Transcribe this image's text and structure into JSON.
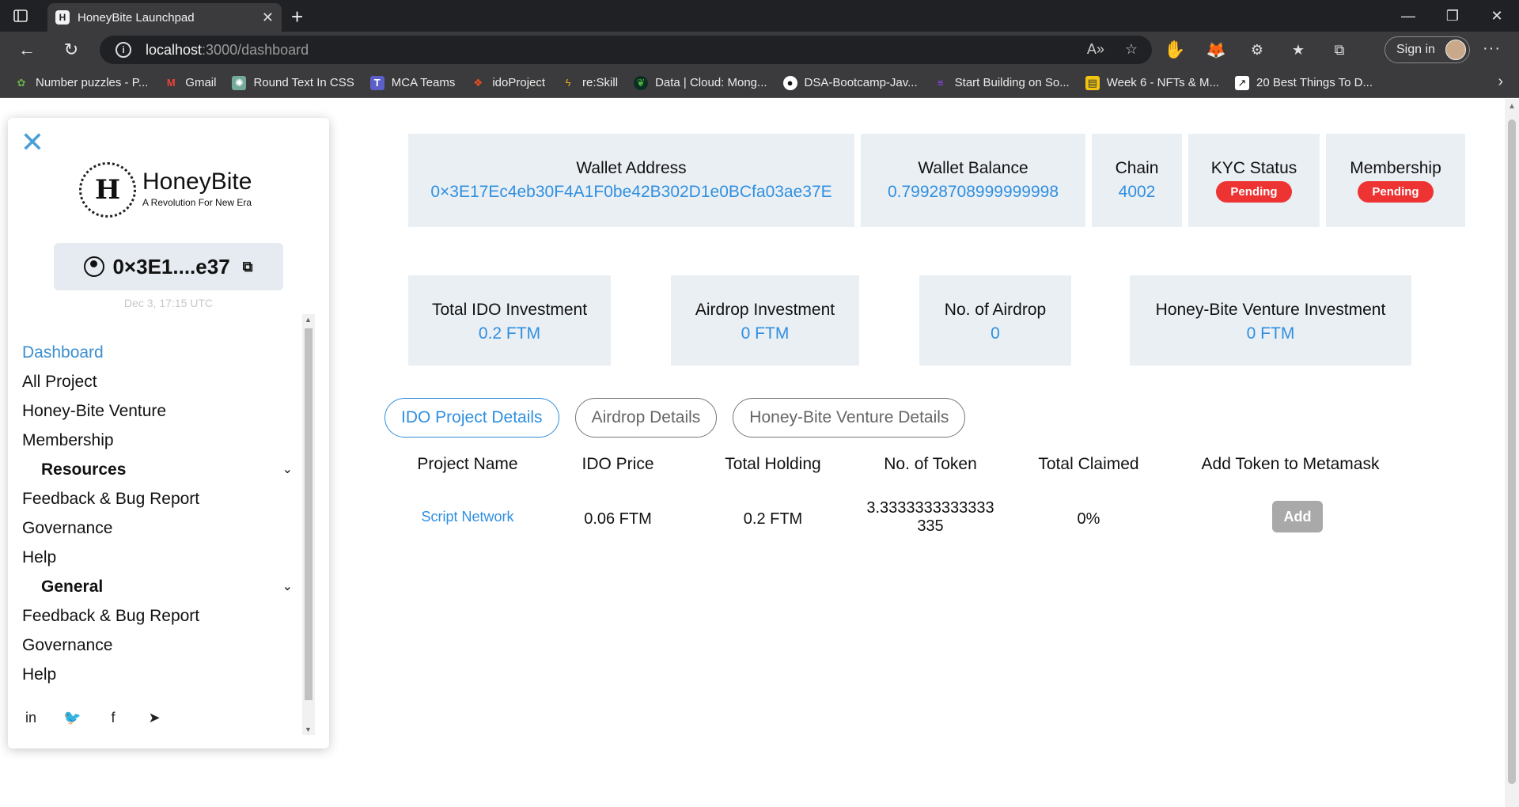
{
  "browser": {
    "tab_title": "HoneyBite Launchpad",
    "url_host": "localhost",
    "url_path": ":3000/dashboard",
    "signin_label": "Sign in",
    "bookmarks": [
      {
        "label": "Number puzzles - P...",
        "icon": "puzzle-icon"
      },
      {
        "label": "Gmail",
        "icon": "gmail-icon"
      },
      {
        "label": "Round Text In CSS",
        "icon": "chatgpt-icon"
      },
      {
        "label": "MCA Teams",
        "icon": "teams-icon"
      },
      {
        "label": "idoProject",
        "icon": "figma-icon"
      },
      {
        "label": "re:Skill",
        "icon": "reskill-icon"
      },
      {
        "label": "Data | Cloud: Mong...",
        "icon": "mongodb-icon"
      },
      {
        "label": "DSA-Bootcamp-Jav...",
        "icon": "github-icon"
      },
      {
        "label": "Start Building on So...",
        "icon": "solana-icon"
      },
      {
        "label": "Week 6 - NFTs & M...",
        "icon": "notebook-icon"
      },
      {
        "label": "20 Best Things To D...",
        "icon": "bookmark-icon"
      }
    ]
  },
  "sidebar": {
    "brand_name": "HoneyBite",
    "brand_tagline": "A Revolution For New Era",
    "crest_letter": "H",
    "wallet_short": "0×3E1....e37",
    "timestamp": "Dec 3, 17:15 UTC",
    "menu": [
      {
        "label": "Dashboard",
        "type": "link",
        "active": true
      },
      {
        "label": "All Project",
        "type": "link"
      },
      {
        "label": "Honey-Bite Venture",
        "type": "link"
      },
      {
        "label": "Membership",
        "type": "link"
      },
      {
        "label": "Resources",
        "type": "section"
      },
      {
        "label": "Feedback & Bug Report",
        "type": "link"
      },
      {
        "label": "Governance",
        "type": "link"
      },
      {
        "label": "Help",
        "type": "link"
      },
      {
        "label": "General",
        "type": "section"
      },
      {
        "label": "Feedback & Bug Report",
        "type": "link"
      },
      {
        "label": "Governance",
        "type": "link"
      },
      {
        "label": "Help",
        "type": "link"
      }
    ]
  },
  "stats_top": {
    "wallet_address_label": "Wallet Address",
    "wallet_address": "0×3E17Ec4eb30F4A1F0be42B302D1e0BCfa03ae37E",
    "wallet_balance_label": "Wallet Balance",
    "wallet_balance": "0.79928708999999998",
    "chain_label": "Chain",
    "chain": "4002",
    "kyc_label": "KYC Status",
    "kyc_status": "Pending",
    "membership_label": "Membership",
    "membership_status": "Pending"
  },
  "stats_bottom": {
    "ido_investment_label": "Total IDO Investment",
    "ido_investment": "0.2 FTM",
    "airdrop_investment_label": "Airdrop Investment",
    "airdrop_investment": "0 FTM",
    "airdrop_count_label": "No. of Airdrop",
    "airdrop_count": "0",
    "venture_investment_label": "Honey-Bite Venture Investment",
    "venture_investment": "0 FTM"
  },
  "tabs": [
    "IDO Project Details",
    "Airdrop Details",
    "Honey-Bite Venture Details"
  ],
  "table": {
    "headers": [
      "Project Name",
      "IDO Price",
      "Total Holding",
      "No. of Token",
      "Total Claimed",
      "Add Token to Metamask"
    ],
    "rows": [
      {
        "project": "Script Network",
        "price": "0.06 FTM",
        "holding": "0.2 FTM",
        "tokens_line1": "3.3333333333333",
        "tokens_line2": "335",
        "claimed": "0%",
        "action": "Add"
      }
    ]
  },
  "colors": {
    "accent": "#2f8fe0",
    "pending": "#e33333",
    "card_bg": "#eaeff4"
  }
}
